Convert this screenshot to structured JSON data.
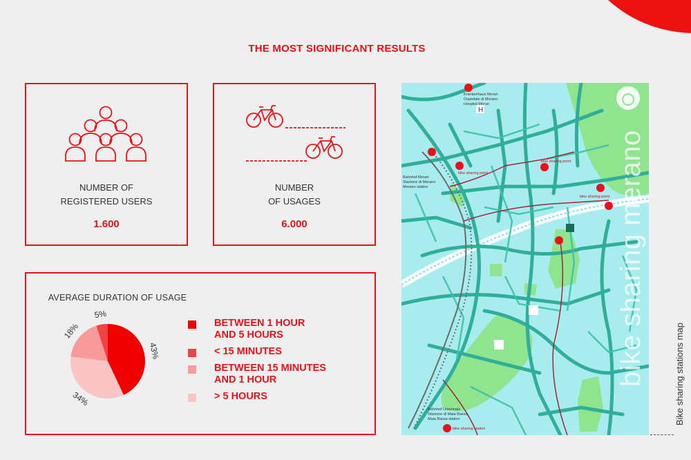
{
  "page": {
    "title": "THE MOST SIGNIFICANT RESULTS"
  },
  "colors": {
    "accent": "#e8111a",
    "map_water": "#a8ecef",
    "map_roads": "#2fae9a",
    "map_parks": "#8ee58e"
  },
  "users_card": {
    "icon": "group-of-people-icon",
    "label_line1": "NUMBER OF",
    "label_line2": "REGISTERED USERS",
    "value": "1.600"
  },
  "usages_card": {
    "icon": "two-bicycles-icon",
    "label_line1": "NUMBER",
    "label_line2": "OF USAGES",
    "value": "6.000"
  },
  "duration_card": {
    "title": "AVERAGE DURATION OF USAGE"
  },
  "chart_data": {
    "type": "pie",
    "categories": [
      "BETWEEN 1 HOUR\nAND 5 HOURS",
      "> 5 HOURS",
      "BETWEEN 15 MINUTES\nAND 1 HOUR",
      "< 15 MINUTES"
    ],
    "values": [
      43,
      34,
      18,
      5
    ],
    "value_labels": [
      "43%",
      "34%",
      "18%",
      "5%"
    ],
    "colors": [
      "#f00000",
      "#fcc5c5",
      "#f99a9a",
      "#f24141"
    ],
    "legend": [
      {
        "label": "BETWEEN 1 HOUR\nAND 5 HOURS",
        "color": "#f00000"
      },
      {
        "label": "< 15 MINUTES",
        "color": "#f24141"
      },
      {
        "label": "BETWEEN 15 MINUTES\nAND 1 HOUR",
        "color": "#f99a9a"
      },
      {
        "label": "> 5 HOURS",
        "color": "#fcc5c5"
      }
    ],
    "legend_position": "right"
  },
  "map": {
    "brand": "bike sharing merano",
    "caption": "Bike sharing stations map",
    "labels": {
      "hospital_1": "Krankenhaus Meran",
      "hospital_2": "Ospedale di Merano",
      "hospital_3": "Hospital Meran",
      "station_1": "Bahnhof Meran",
      "station_2": "Stazione di Merano",
      "station_3": "Merano station",
      "maia_1": "Bahnhof Untermais",
      "maia_2": "Stazione di Maia Bassa",
      "maia_3": "Maia Bassa station",
      "point_1": "bike sharing point",
      "point_2": "bike sharing point",
      "point_3": "bike sharing point",
      "station_bottom": "bike sharing station"
    }
  }
}
